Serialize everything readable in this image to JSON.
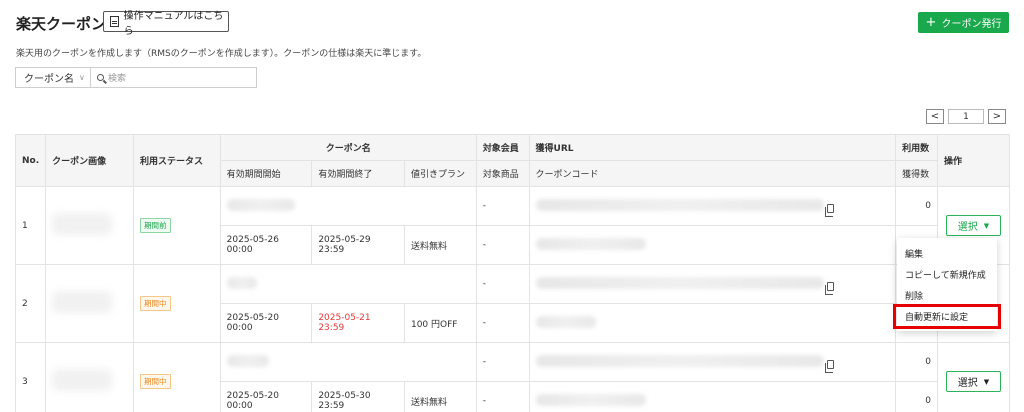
{
  "header": {
    "title": "楽天クーポン",
    "manual_button": "操作マニュアルはこちら",
    "issue_button": "クーポン発行",
    "description": "楽天用のクーポンを作成します（RMSのクーポンを作成します）。クーポンの仕様は楽天に準じます。"
  },
  "filter": {
    "field": "クーポン名",
    "placeholder": "検索"
  },
  "pager": {
    "page": "1"
  },
  "table": {
    "headers": {
      "no": "No.",
      "image": "クーポン画像",
      "status": "利用ステータス",
      "name": "クーポン名",
      "member": "対象会員",
      "url": "獲得URL",
      "usage": "利用数",
      "action": "操作",
      "start": "有効期間開始",
      "end": "有効期間終了",
      "plan": "値引きプラン",
      "product": "対象商品",
      "code": "クーポンコード",
      "acquired": "獲得数"
    },
    "rows": [
      {
        "no": "1",
        "status": "期間前",
        "member": "-",
        "usage": "0",
        "start": "2025-05-26 00:00",
        "end": "2025-05-29 23:59",
        "plan": "送料無料",
        "product": "-",
        "acquired": "0",
        "action": "選択"
      },
      {
        "no": "2",
        "status": "期間中",
        "member": "-",
        "usage": "",
        "start": "2025-05-20 00:00",
        "end": "2025-05-21 23:59",
        "plan": "100 円OFF",
        "product": "-",
        "acquired": "",
        "action": ""
      },
      {
        "no": "3",
        "status": "期間中",
        "member": "-",
        "usage": "0",
        "start": "2025-05-20 00:00",
        "end": "2025-05-30 23:59",
        "plan": "送料無料",
        "product": "-",
        "acquired": "0",
        "action": "選択"
      }
    ]
  },
  "dropdown": {
    "items": [
      "編集",
      "コピーして新規作成",
      "削除",
      "自動更新に設定"
    ],
    "highlighted_color": "#e60000"
  },
  "colors": {
    "accent": "#19a84b",
    "expired_date": "#e23b3b"
  }
}
